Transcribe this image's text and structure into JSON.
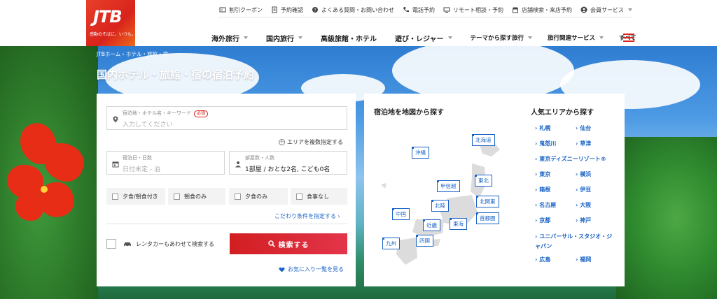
{
  "header": {
    "logo_text": "JTB",
    "logo_tagline": "感動のそばに、いつも。",
    "utility_nav": [
      {
        "icon": "coupon-icon",
        "label": "割引クーポン"
      },
      {
        "icon": "reservation-icon",
        "label": "予約確認"
      },
      {
        "icon": "faq-icon",
        "label": "よくある質問・お問い合わせ"
      },
      {
        "icon": "phone-icon",
        "label": "電話予約"
      },
      {
        "icon": "remote-icon",
        "label": "リモート相談・予約"
      },
      {
        "icon": "store-icon",
        "label": "店舗検索・来店予約"
      },
      {
        "icon": "member-icon",
        "label": "会員サービス"
      }
    ],
    "main_nav": [
      {
        "label": "海外旅行"
      },
      {
        "label": "国内旅行"
      },
      {
        "label": "高級旅館・ホテル"
      },
      {
        "label": "遊び・レジャー"
      },
      {
        "label": "テーマから探す旅行"
      },
      {
        "label": "旅行関連サービス"
      },
      {
        "label": "すべて"
      }
    ]
  },
  "breadcrumb": "JTBホーム › ホテル・旅館・宿",
  "page_title": "国内ホテル・旅館・宿の宿泊予約",
  "search": {
    "destination_label": "宿泊地・ホテル名・キーワード",
    "required_badge": "必須",
    "destination_placeholder": "入力してください",
    "multi_area_link": "エリアを複数指定する",
    "date_label": "宿泊日・日数",
    "date_placeholder": "日付未定 - 泊",
    "guests_label": "部屋数・人数",
    "guests_value": "1部屋 / おとな2名, こども0名",
    "meal_options": [
      "夕食/朝食付き",
      "朝食のみ",
      "夕食のみ",
      "食事なし"
    ],
    "advanced_link": "こだわり条件を指定する ›",
    "rental_label": "レンタカーもあわせて検索する",
    "search_button": "検索する",
    "favorites_link": "お気に入り一覧を見る"
  },
  "map": {
    "title": "宿泊地を地図から探す",
    "regions": [
      "沖縄",
      "北海道",
      "甲信越",
      "東北",
      "北関東",
      "北陸",
      "中国",
      "近畿",
      "東海",
      "首都圏",
      "九州",
      "四国"
    ]
  },
  "popular": {
    "title": "人気エリアから探す",
    "areas": [
      "札幌",
      "仙台",
      "鬼怒川",
      "草津",
      "東京ディズニーリゾート®",
      "東京",
      "横浜",
      "箱根",
      "伊豆",
      "名古屋",
      "大阪",
      "京都",
      "神戸",
      "ユニバーサル・スタジオ・ジャパン",
      "広島",
      "福岡"
    ]
  },
  "colors": {
    "brand_red": "#d8231c",
    "link_blue": "#1a63c6"
  }
}
